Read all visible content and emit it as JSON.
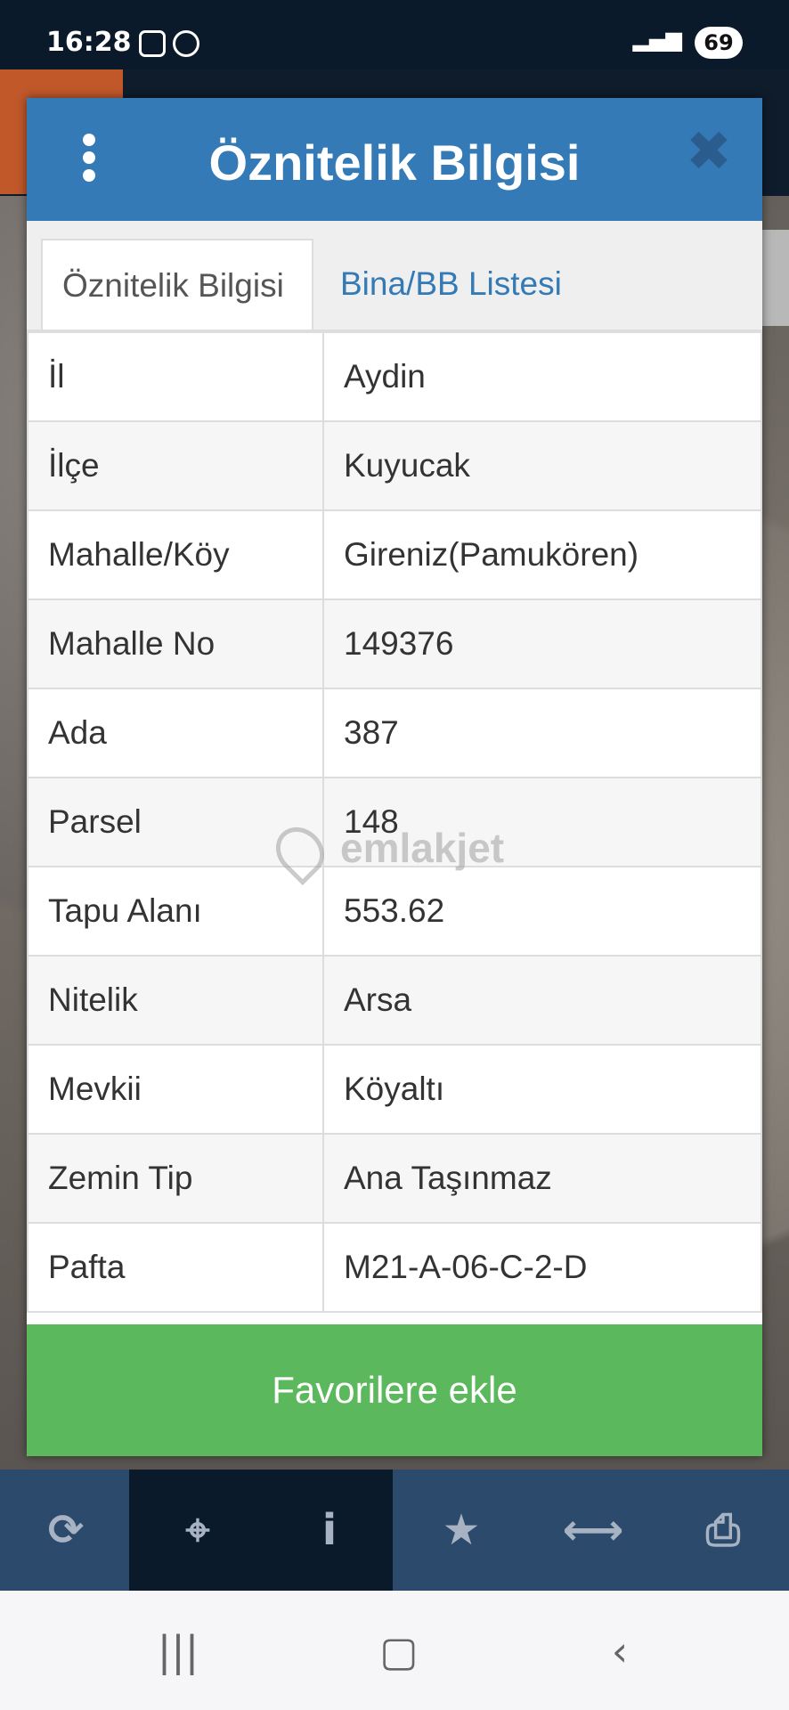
{
  "status_bar": {
    "time": "16:28",
    "battery": "69"
  },
  "dialog": {
    "title": "Öznitelik Bilgisi",
    "tabs": [
      {
        "label": "Öznitelik Bilgisi",
        "active": true
      },
      {
        "label": "Bina/BB Listesi",
        "active": false
      }
    ],
    "rows": [
      {
        "key": "İl",
        "value": "Aydin"
      },
      {
        "key": "İlçe",
        "value": "Kuyucak"
      },
      {
        "key": "Mahalle/Köy",
        "value": "Gireniz(Pamukören)"
      },
      {
        "key": "Mahalle No",
        "value": "149376"
      },
      {
        "key": "Ada",
        "value": "387"
      },
      {
        "key": "Parsel",
        "value": "148"
      },
      {
        "key": "Tapu Alanı",
        "value": "553.62"
      },
      {
        "key": "Nitelik",
        "value": "Arsa"
      },
      {
        "key": "Mevkii",
        "value": "Köyaltı"
      },
      {
        "key": "Zemin Tip",
        "value": "Ana Taşınmaz"
      },
      {
        "key": "Pafta",
        "value": "M21-A-06-C-2-D"
      }
    ],
    "favorite_button": "Favorilere ekle"
  },
  "watermark": "emlakjet",
  "toolbar": {
    "icons": [
      "refresh-icon",
      "locate-icon",
      "info-icon",
      "star-icon",
      "measure-icon",
      "print-icon"
    ]
  },
  "colors": {
    "header": "#337ab7",
    "button": "#5cb85c",
    "toolbar": "#2c4a6b"
  }
}
